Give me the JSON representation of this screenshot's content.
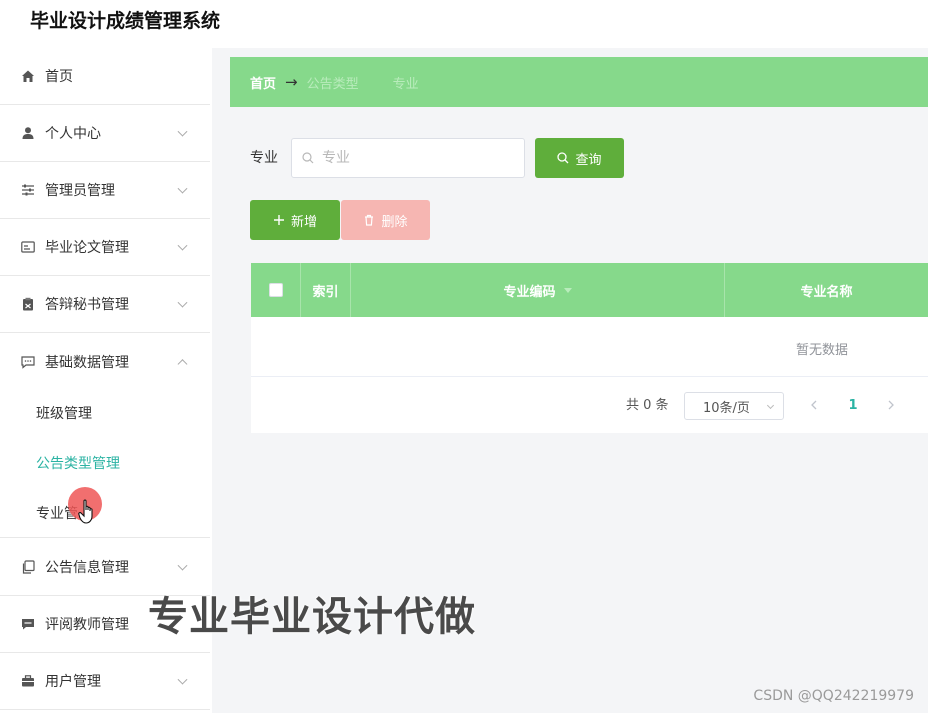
{
  "app": {
    "title": "毕业设计成绩管理系统"
  },
  "sidebar": {
    "items": [
      {
        "label": "首页"
      },
      {
        "label": "个人中心"
      },
      {
        "label": "管理员管理"
      },
      {
        "label": "毕业论文管理"
      },
      {
        "label": "答辩秘书管理"
      },
      {
        "label": "基础数据管理"
      },
      {
        "label": "公告信息管理"
      },
      {
        "label": "评阅教师管理"
      },
      {
        "label": "用户管理"
      }
    ],
    "submenu": [
      {
        "label": "班级管理"
      },
      {
        "label": "公告类型管理"
      },
      {
        "label": "专业管"
      }
    ]
  },
  "breadcrumb": {
    "home": "首页",
    "separator": "→",
    "level1": "公告类型",
    "current": "专业"
  },
  "search": {
    "label": "专业",
    "placeholder": "专业",
    "value": "",
    "query_label": "查询"
  },
  "actions": {
    "add_label": "新增",
    "delete_label": "删除"
  },
  "table": {
    "columns": [
      "索引",
      "专业编码",
      "专业名称"
    ],
    "rows": [],
    "empty_text": "暂无数据"
  },
  "pagination": {
    "total_text": "共 0 条",
    "page_size": "10条/页",
    "current_page": "1"
  },
  "overlay": {
    "promo_text": "专业毕业设计代做",
    "watermark": "CSDN @QQ242219979"
  },
  "colors": {
    "primary_green": "#86d98b",
    "button_green": "#5fae3b",
    "delete_pink": "#f6b6b2",
    "active_teal": "#2bb3a3"
  }
}
